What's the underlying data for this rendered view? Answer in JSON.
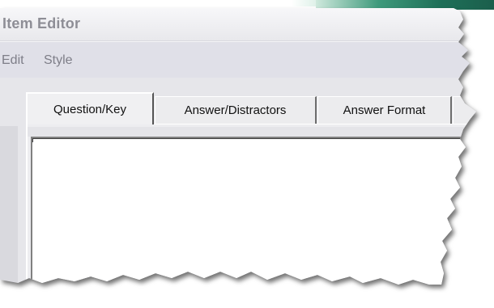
{
  "window": {
    "title": "Item Editor"
  },
  "menu": {
    "items": [
      "Edit",
      "Style"
    ]
  },
  "tabs": [
    {
      "label": "Question/Key",
      "selected": true
    },
    {
      "label": "Answer/Distractors",
      "selected": false
    },
    {
      "label": "Answer Format",
      "selected": false
    }
  ],
  "editor": {
    "content": ""
  },
  "colors": {
    "accent": "#1e6f58",
    "window_bg": "#d9d9de",
    "title_text": "#8e8e96",
    "menu_text": "#7e7e88"
  }
}
